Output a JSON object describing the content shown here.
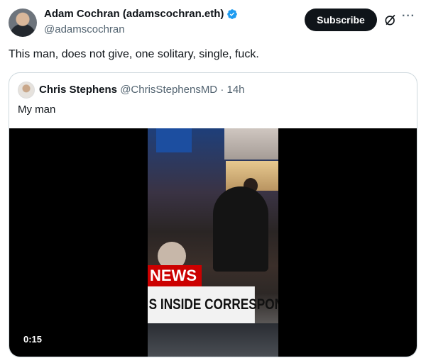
{
  "author": {
    "display_name": "Adam Cochran (adamscochran.eth)",
    "handle": "@adamscochran",
    "verified_icon": "verified-badge-icon",
    "verified_color": "#1d9bf0"
  },
  "actions": {
    "subscribe_label": "Subscribe",
    "grok_icon": "grok-icon",
    "more_label": "···"
  },
  "tweet": {
    "text": "This man, does not give, one solitary, single, fuck."
  },
  "quoted_tweet": {
    "display_name": "Chris Stephens",
    "handle": "@ChrisStephensMD",
    "separator": "·",
    "age": "14h",
    "text": "My man",
    "video": {
      "duration": "0:15",
      "news_text": "NEWS",
      "lower_third_text": "S INSIDE CORRESPON",
      "news_color": "#cc0000"
    }
  }
}
